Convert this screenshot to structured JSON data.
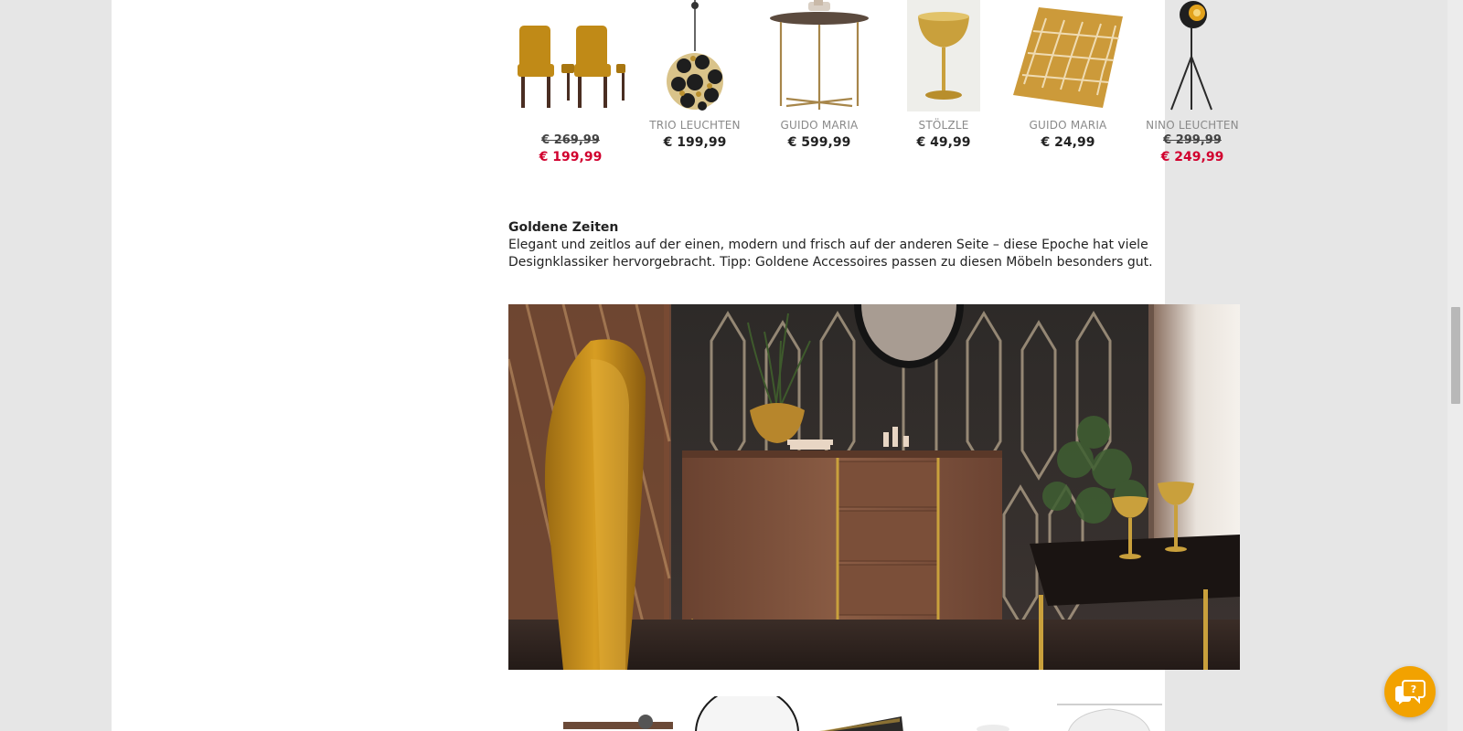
{
  "products": [
    {
      "brand": "",
      "price_old": "€ 269,99",
      "price": "€ 199,99",
      "sale": true,
      "icon": "dining-chairs"
    },
    {
      "brand": "TRIO LEUCHTEN",
      "price_old": "",
      "price": "€ 199,99",
      "sale": false,
      "icon": "pendant-lamp"
    },
    {
      "brand": "GUIDO MARIA",
      "price_old": "",
      "price": "€ 599,99",
      "sale": false,
      "icon": "side-table"
    },
    {
      "brand": "STÖLZLE",
      "price_old": "",
      "price": "€ 49,99",
      "sale": false,
      "icon": "champagne-glass"
    },
    {
      "brand": "GUIDO MARIA",
      "price_old": "",
      "price": "€ 24,99",
      "sale": false,
      "icon": "rug"
    },
    {
      "brand": "NINO LEUCHTEN",
      "price_old": "€ 299,99",
      "price": "€ 249,99",
      "sale": true,
      "icon": "floor-lamp"
    }
  ],
  "article": {
    "title": "Goldene Zeiten",
    "body": "Elegant und zeitlos auf der einen, modern und frisch auf der anderen Seite – diese Epoche hat viele Designklassiker hervorgebracht. Tipp: Goldene Accessoires passen zu diesen Möbeln besonders gut."
  },
  "hero": {
    "icon": "interior-photo-sideboard"
  },
  "chat": {
    "icon": "chat-help-icon"
  },
  "colors": {
    "sale": "#d1002e",
    "chat": "#f2a200",
    "gold": "#c9a03c"
  }
}
